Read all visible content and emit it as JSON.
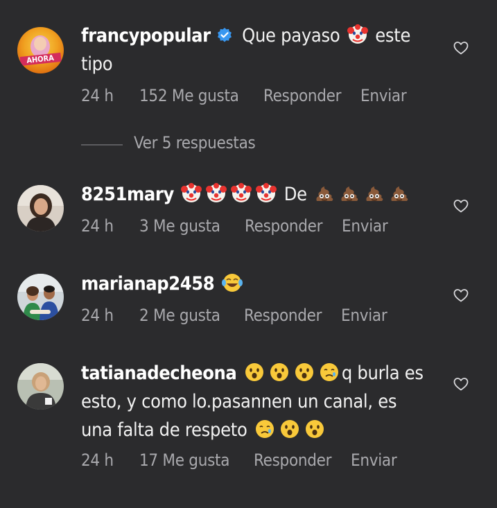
{
  "comments": [
    {
      "username": "francypopular",
      "verified": true,
      "lines": [
        [
          {
            "t": "text",
            "v": " Que payaso "
          },
          {
            "t": "emoji",
            "v": "clown-face"
          },
          {
            "t": "text",
            "v": " este"
          }
        ],
        [
          {
            "t": "text",
            "v": "tipo"
          }
        ]
      ],
      "time": "24 h",
      "likes": "152 Me gusta",
      "reply": "Responder",
      "send": "Enviar",
      "avatar_text": "AHORA"
    },
    {
      "username": "8251mary",
      "lines": [
        [
          {
            "t": "emoji",
            "v": "clown-face"
          },
          {
            "t": "emoji",
            "v": "clown-face"
          },
          {
            "t": "emoji",
            "v": "clown-face"
          },
          {
            "t": "emoji",
            "v": "clown-face"
          },
          {
            "t": "text",
            "v": " De "
          },
          {
            "t": "emoji",
            "v": "pile-of-poo"
          },
          {
            "t": "emoji",
            "v": "pile-of-poo"
          },
          {
            "t": "emoji",
            "v": "pile-of-poo"
          },
          {
            "t": "emoji",
            "v": "pile-of-poo"
          }
        ]
      ],
      "time": "24 h",
      "likes": "3 Me gusta",
      "reply": "Responder",
      "send": "Enviar"
    },
    {
      "username": "marianap2458",
      "lines": [
        [
          {
            "t": "emoji",
            "v": "tears-of-joy"
          }
        ]
      ],
      "time": "24 h",
      "likes": "2 Me gusta",
      "reply": "Responder",
      "send": "Enviar"
    },
    {
      "username": "tatianadecheona",
      "lines": [
        [
          {
            "t": "emoji",
            "v": "hushed-face"
          },
          {
            "t": "emoji",
            "v": "hushed-face"
          },
          {
            "t": "emoji",
            "v": "hushed-face"
          },
          {
            "t": "emoji",
            "v": "crying-face"
          },
          {
            "t": "text",
            "v": "q burla es"
          }
        ],
        [
          {
            "t": "text",
            "v": "esto, y como lo.pasannen un canal, es"
          }
        ],
        [
          {
            "t": "text",
            "v": "una falta de respeto "
          },
          {
            "t": "emoji",
            "v": "crying-face"
          },
          {
            "t": "emoji",
            "v": "hushed-face"
          },
          {
            "t": "emoji",
            "v": "hushed-face"
          }
        ]
      ],
      "time": "24 h",
      "likes": "17 Me gusta",
      "reply": "Responder",
      "send": "Enviar"
    }
  ],
  "view_replies": "Ver 5 respuestas",
  "colors": {
    "background": "#2b2b2d",
    "text": "#f2f2f2",
    "meta": "#a9a9ad",
    "verified": "#3897f0"
  }
}
